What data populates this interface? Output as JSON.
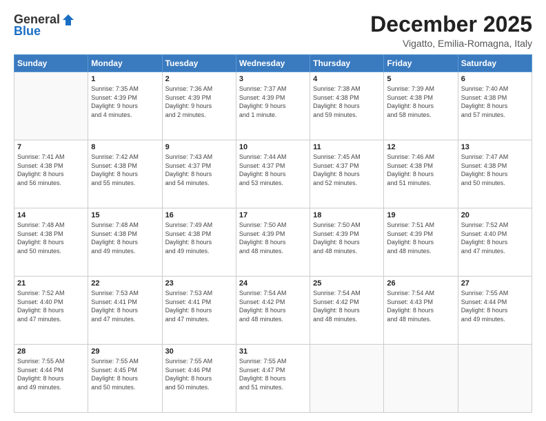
{
  "header": {
    "logo_general": "General",
    "logo_blue": "Blue",
    "month_title": "December 2025",
    "location": "Vigatto, Emilia-Romagna, Italy"
  },
  "days_of_week": [
    "Sunday",
    "Monday",
    "Tuesday",
    "Wednesday",
    "Thursday",
    "Friday",
    "Saturday"
  ],
  "weeks": [
    [
      {
        "day": "",
        "info": ""
      },
      {
        "day": "1",
        "info": "Sunrise: 7:35 AM\nSunset: 4:39 PM\nDaylight: 9 hours\nand 4 minutes."
      },
      {
        "day": "2",
        "info": "Sunrise: 7:36 AM\nSunset: 4:39 PM\nDaylight: 9 hours\nand 2 minutes."
      },
      {
        "day": "3",
        "info": "Sunrise: 7:37 AM\nSunset: 4:39 PM\nDaylight: 9 hours\nand 1 minute."
      },
      {
        "day": "4",
        "info": "Sunrise: 7:38 AM\nSunset: 4:38 PM\nDaylight: 8 hours\nand 59 minutes."
      },
      {
        "day": "5",
        "info": "Sunrise: 7:39 AM\nSunset: 4:38 PM\nDaylight: 8 hours\nand 58 minutes."
      },
      {
        "day": "6",
        "info": "Sunrise: 7:40 AM\nSunset: 4:38 PM\nDaylight: 8 hours\nand 57 minutes."
      }
    ],
    [
      {
        "day": "7",
        "info": "Sunrise: 7:41 AM\nSunset: 4:38 PM\nDaylight: 8 hours\nand 56 minutes."
      },
      {
        "day": "8",
        "info": "Sunrise: 7:42 AM\nSunset: 4:38 PM\nDaylight: 8 hours\nand 55 minutes."
      },
      {
        "day": "9",
        "info": "Sunrise: 7:43 AM\nSunset: 4:37 PM\nDaylight: 8 hours\nand 54 minutes."
      },
      {
        "day": "10",
        "info": "Sunrise: 7:44 AM\nSunset: 4:37 PM\nDaylight: 8 hours\nand 53 minutes."
      },
      {
        "day": "11",
        "info": "Sunrise: 7:45 AM\nSunset: 4:37 PM\nDaylight: 8 hours\nand 52 minutes."
      },
      {
        "day": "12",
        "info": "Sunrise: 7:46 AM\nSunset: 4:38 PM\nDaylight: 8 hours\nand 51 minutes."
      },
      {
        "day": "13",
        "info": "Sunrise: 7:47 AM\nSunset: 4:38 PM\nDaylight: 8 hours\nand 50 minutes."
      }
    ],
    [
      {
        "day": "14",
        "info": "Sunrise: 7:48 AM\nSunset: 4:38 PM\nDaylight: 8 hours\nand 50 minutes."
      },
      {
        "day": "15",
        "info": "Sunrise: 7:48 AM\nSunset: 4:38 PM\nDaylight: 8 hours\nand 49 minutes."
      },
      {
        "day": "16",
        "info": "Sunrise: 7:49 AM\nSunset: 4:38 PM\nDaylight: 8 hours\nand 49 minutes."
      },
      {
        "day": "17",
        "info": "Sunrise: 7:50 AM\nSunset: 4:39 PM\nDaylight: 8 hours\nand 48 minutes."
      },
      {
        "day": "18",
        "info": "Sunrise: 7:50 AM\nSunset: 4:39 PM\nDaylight: 8 hours\nand 48 minutes."
      },
      {
        "day": "19",
        "info": "Sunrise: 7:51 AM\nSunset: 4:39 PM\nDaylight: 8 hours\nand 48 minutes."
      },
      {
        "day": "20",
        "info": "Sunrise: 7:52 AM\nSunset: 4:40 PM\nDaylight: 8 hours\nand 47 minutes."
      }
    ],
    [
      {
        "day": "21",
        "info": "Sunrise: 7:52 AM\nSunset: 4:40 PM\nDaylight: 8 hours\nand 47 minutes."
      },
      {
        "day": "22",
        "info": "Sunrise: 7:53 AM\nSunset: 4:41 PM\nDaylight: 8 hours\nand 47 minutes."
      },
      {
        "day": "23",
        "info": "Sunrise: 7:53 AM\nSunset: 4:41 PM\nDaylight: 8 hours\nand 47 minutes."
      },
      {
        "day": "24",
        "info": "Sunrise: 7:54 AM\nSunset: 4:42 PM\nDaylight: 8 hours\nand 48 minutes."
      },
      {
        "day": "25",
        "info": "Sunrise: 7:54 AM\nSunset: 4:42 PM\nDaylight: 8 hours\nand 48 minutes."
      },
      {
        "day": "26",
        "info": "Sunrise: 7:54 AM\nSunset: 4:43 PM\nDaylight: 8 hours\nand 48 minutes."
      },
      {
        "day": "27",
        "info": "Sunrise: 7:55 AM\nSunset: 4:44 PM\nDaylight: 8 hours\nand 49 minutes."
      }
    ],
    [
      {
        "day": "28",
        "info": "Sunrise: 7:55 AM\nSunset: 4:44 PM\nDaylight: 8 hours\nand 49 minutes."
      },
      {
        "day": "29",
        "info": "Sunrise: 7:55 AM\nSunset: 4:45 PM\nDaylight: 8 hours\nand 50 minutes."
      },
      {
        "day": "30",
        "info": "Sunrise: 7:55 AM\nSunset: 4:46 PM\nDaylight: 8 hours\nand 50 minutes."
      },
      {
        "day": "31",
        "info": "Sunrise: 7:55 AM\nSunset: 4:47 PM\nDaylight: 8 hours\nand 51 minutes."
      },
      {
        "day": "",
        "info": ""
      },
      {
        "day": "",
        "info": ""
      },
      {
        "day": "",
        "info": ""
      }
    ]
  ]
}
